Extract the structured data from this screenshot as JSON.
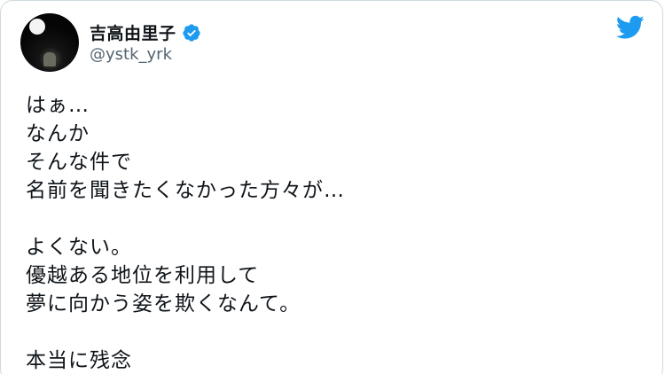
{
  "author": {
    "display_name": "吉高由里子",
    "handle": "@ystk_yrk",
    "verified": true
  },
  "icons": {
    "verified": "verified-badge-icon",
    "brand": "twitter-bird-icon"
  },
  "colors": {
    "brand_blue": "#1d9bf0",
    "text_primary": "#0f1419",
    "text_secondary": "#536471"
  },
  "tweet": {
    "lines": [
      "はぁ…",
      "なんか",
      "そんな件で",
      "名前を聞きたくなかった方々が…",
      "",
      "よくない。",
      "優越ある地位を利用して",
      "夢に向かう姿を欺くなんて。",
      "",
      "本当に残念"
    ]
  }
}
